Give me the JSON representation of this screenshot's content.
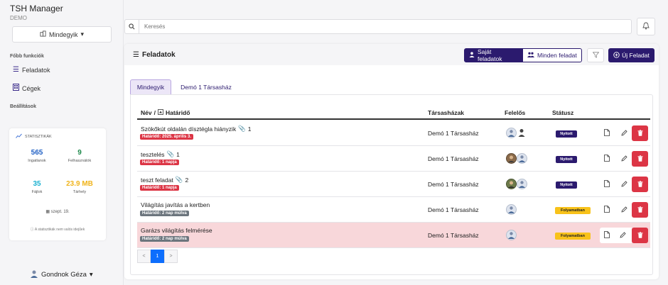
{
  "app": {
    "title": "TSH Manager",
    "env": "DEMO"
  },
  "sidebar": {
    "select_label": "Mindegyik",
    "section_main": "Főbb funkciók",
    "items": [
      {
        "label": "Feladatok",
        "icon": "list-icon"
      },
      {
        "label": "Cégek",
        "icon": "building-icon"
      }
    ],
    "section_settings": "Beállítások",
    "user_name": "Gondnok Géza"
  },
  "stats": {
    "title": "STATISZTIKÁK",
    "properties": {
      "value": "565",
      "label": "Ingatlanok"
    },
    "users": {
      "value": "9",
      "label": "Felhasználók"
    },
    "files": {
      "value": "35",
      "label": "Fájlok"
    },
    "storage": {
      "value": "23.9 MB",
      "label": "Tárhely"
    },
    "date": "szept. 19.",
    "note": "A statisztikák nem valós idejűek"
  },
  "search": {
    "placeholder": "Keresés"
  },
  "header": {
    "title": "Feladatok",
    "own_tasks": "Saját feladatok",
    "all_tasks": "Minden feladat",
    "new_task": "Új Feladat"
  },
  "tabs": [
    "Mindegyik",
    "Demó 1 Társasház"
  ],
  "table": {
    "col_name": "Név",
    "col_due": "Határidő",
    "col_company": "Társasházak",
    "col_owner": "Felelős",
    "col_status": "Státusz",
    "rows": [
      {
        "name": "Szökőkút oldalán dísztégla hiányzik",
        "files": "1",
        "due": "Határidő: 2025. április 3.",
        "company": "Demó 1 Társasház",
        "status": "Nyitott"
      },
      {
        "name": "tesztelés",
        "files": "1",
        "due": "Határidő: 1 napja",
        "company": "Demó 1 Társasház",
        "status": "Nyitott"
      },
      {
        "name": "teszt feladat",
        "files": "2",
        "due": "Határidő: 1 napja",
        "company": "Demó 1 Társasház",
        "status": "Nyitott"
      },
      {
        "name": "Világítás javítás a kertben",
        "files": "",
        "due": "Határidő: 2 nap múlva",
        "company": "Demó 1 Társasház",
        "status": "Folyamatban"
      },
      {
        "name": "Garázs világítás felmérése",
        "files": "",
        "due": "Határidő: 2 nap múlva",
        "company": "Demó 1 Társasház",
        "status": "Folyamatban"
      }
    ]
  },
  "pagination": {
    "prev": "<",
    "current": "1",
    "next": ">"
  },
  "colors": {
    "primary": "#2b1a6e",
    "danger": "#dc3545",
    "warning": "#f8c21a",
    "highlight": "#f8d7da",
    "pager_active": "#0d6efd"
  }
}
